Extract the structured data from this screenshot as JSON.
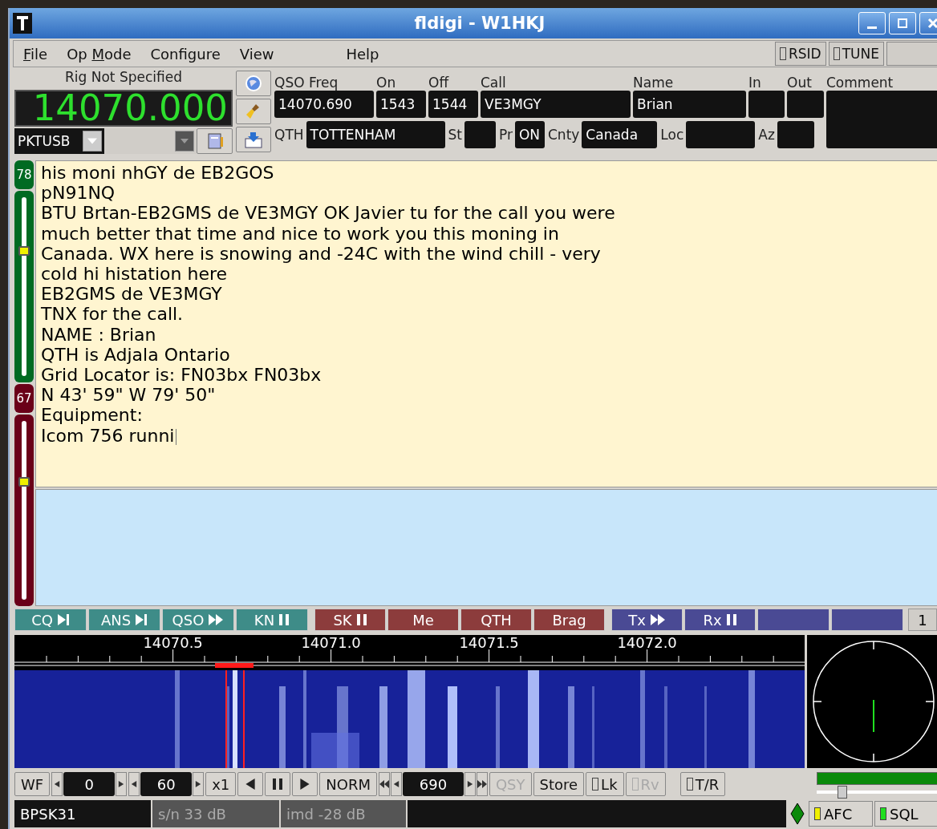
{
  "window": {
    "title": "fldigi - W1HKJ"
  },
  "menu": [
    {
      "label": "File"
    },
    {
      "label": "Op Mode"
    },
    {
      "label": "Configure"
    },
    {
      "label": "View"
    },
    {
      "label": "Help"
    }
  ],
  "toggles": [
    {
      "label": "RSID",
      "on": false
    },
    {
      "label": "TUNE",
      "on": false
    }
  ],
  "rig": {
    "label": "Rig Not Specified",
    "frequency": "14070.000",
    "mode": "PKTUSB"
  },
  "log_row_1": [
    {
      "label": "QSO Freq",
      "value": "14070.690"
    },
    {
      "label": "On",
      "value": "1543"
    },
    {
      "label": "Off",
      "value": "1544"
    },
    {
      "label": "Call",
      "value": "VE3MGY"
    },
    {
      "label": "Name",
      "value": "Brian"
    },
    {
      "label": "In"
    },
    {
      "label": "Out"
    }
  ],
  "comment_label": "Comment",
  "log_row_2": [
    {
      "label": "QTH",
      "value": "TOTTENHAM"
    },
    {
      "label": "St"
    },
    {
      "label": "Pr",
      "value": "ON"
    },
    {
      "label": "Cnty",
      "value": "Canada"
    },
    {
      "label": "Loc"
    },
    {
      "label": "Az"
    }
  ],
  "side_sliders": [
    {
      "reading": "78",
      "level": 0.7,
      "color": "#006a22"
    },
    {
      "reading": "67",
      "level": 0.66,
      "color": "#6a0018"
    }
  ],
  "rx_text": [
    "his moni nhGY de EB2GOS",
    "pN91NQ",
    "BTU Brtan-EB2GMS de VE3MGY OK Javier tu for the call you were",
    "much better that time and nice to work you this moning in",
    "Canada. WX here is snowing and -24C with the wind chill - very",
    "cold hi histation here",
    "EB2GMS de VE3MGY",
    "TNX for the call.",
    "NAME : Brian",
    "QTH is Adjala Ontario",
    "Grid Locator is: FN03bx FN03bx",
    "N 43' 59\" W 79' 50\"",
    "Equipment:",
    "Icom 756 runni"
  ],
  "macros": [
    {
      "label": "CQ",
      "color": "#3e8c88"
    },
    {
      "label": "ANS",
      "color": "#3e8c88"
    },
    {
      "label": "QSO",
      "color": "#3e8c88"
    },
    {
      "label": "KN",
      "color": "#3e8c88"
    },
    {
      "label": "SK",
      "color": "#8c3c3c"
    },
    {
      "label": "Me",
      "color": "#8c3c3c"
    },
    {
      "label": "QTH",
      "color": "#8c3c3c"
    },
    {
      "label": "Brag",
      "color": "#8c3c3c"
    },
    {
      "label": "Tx",
      "color": "#4a4a94"
    },
    {
      "label": "Rx",
      "color": "#4a4a94"
    },
    {
      "color": "#4a4a94"
    },
    {
      "color": "#4a4a94"
    }
  ],
  "macro_page": "1",
  "waterfall": {
    "scale_labels": [
      "14070.5",
      "14071.0",
      "14071.5",
      "14072.0"
    ]
  },
  "controls": [
    {
      "kind": "button",
      "label": "WF",
      "disabled": false
    },
    {
      "kind": "spinner",
      "value": "0"
    },
    {
      "kind": "spinner",
      "value": "60"
    },
    {
      "kind": "button",
      "label": "x1",
      "disabled": false
    },
    {
      "kind": "step_left"
    },
    {
      "kind": "pause"
    },
    {
      "kind": "step_right"
    },
    {
      "kind": "button",
      "label": "NORM",
      "disabled": false
    },
    {
      "kind": "double_spinner",
      "value": "690"
    },
    {
      "kind": "button",
      "label": "QSY",
      "disabled": true
    },
    {
      "kind": "button",
      "label": "Store",
      "disabled": false
    },
    {
      "kind": "toggle",
      "label": "Lk",
      "on": false,
      "disabled": false
    },
    {
      "kind": "toggle",
      "label": "Rv",
      "on": false,
      "disabled": true
    },
    {
      "kind": "toggle",
      "label": "T/R",
      "on": false,
      "disabled": false
    }
  ],
  "signal": {
    "level": 1
  },
  "squelch": {
    "level": 0.2
  },
  "status": {
    "mode": "BPSK31",
    "snr": "s/n 33 dB",
    "imd": "imd -28 dB",
    "lights": [
      {
        "label": "AFC",
        "on": true,
        "color": "#f0f000"
      },
      {
        "label": "SQL",
        "on": true,
        "color": "#20e020"
      }
    ]
  }
}
